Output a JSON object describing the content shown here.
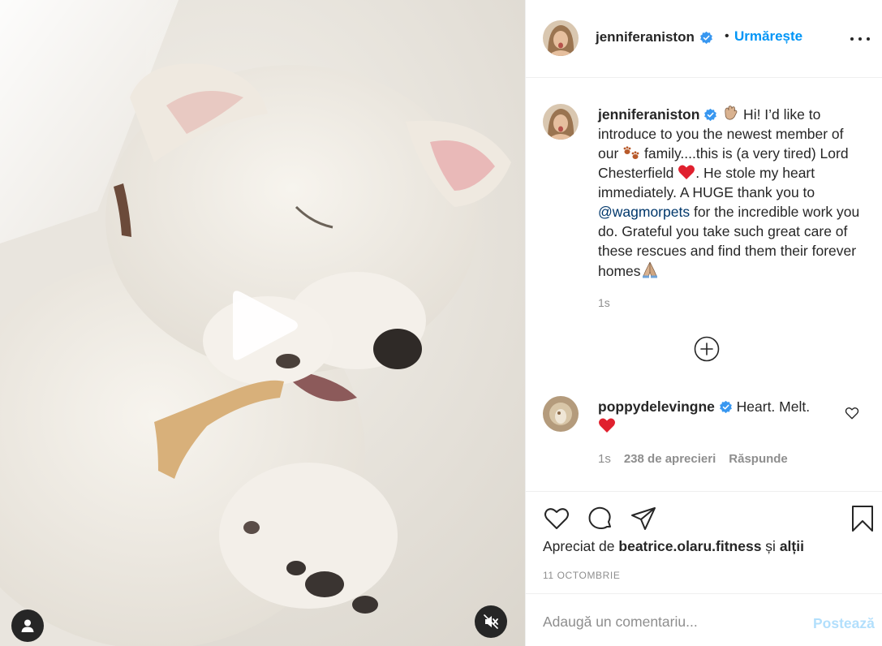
{
  "post": {
    "author": "jenniferaniston",
    "follow_label": "Urmărește",
    "dot": "•",
    "caption_user": "jenniferaniston",
    "caption_part1": " Hi! I’d like to introduce to you the newest member of our ",
    "caption_part2": " family....this is (a very tired) Lord Chesterfield ",
    "caption_part3": ". He stole my heart immediately. A HUGE thank you to ",
    "mention": "@wagmorpets",
    "caption_part4": " for the incredible work you do. Grateful you take such great care of these rescues and find them their forever homes",
    "caption_time": "1s"
  },
  "comment": {
    "user": "poppydelevingne",
    "text": " Heart. Melt. ",
    "time": "1s",
    "likes": "238 de aprecieri",
    "reply": "Răspunde"
  },
  "footer": {
    "liked_prefix": "Apreciat de ",
    "liked_user": "beatrice.olaru.fitness",
    "liked_and": " și ",
    "liked_others": "alții",
    "date": "11 OCTOMBRIE",
    "comment_placeholder": "Adaugă un comentariu...",
    "post_label": "Postează"
  },
  "icons": {
    "header": [
      "verified-icon",
      "more-options-icon"
    ],
    "media": [
      "play-icon",
      "user-tag-icon",
      "muted-speaker-icon"
    ],
    "actions": [
      "heart-icon",
      "comment-icon",
      "share-icon",
      "bookmark-icon"
    ],
    "emoji": [
      "waving-hand-emoji",
      "paw-prints-emoji",
      "red-heart-emoji",
      "folded-hands-emoji"
    ]
  },
  "colors": {
    "link_blue": "#0095f6",
    "mention": "#00376b",
    "verified": "#3897f0",
    "muted_text": "#8e8e8e",
    "post_disabled": "#b2dffc",
    "heart_red": "#ed4956"
  }
}
